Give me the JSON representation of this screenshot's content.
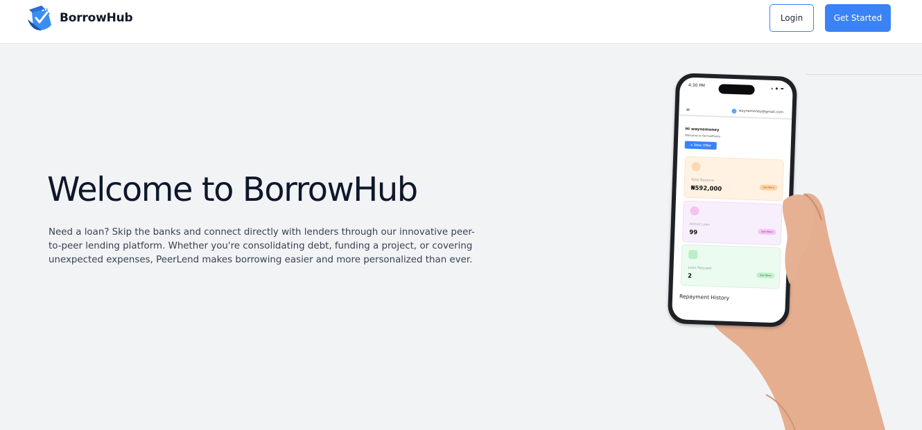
{
  "header": {
    "brand": "BorrowHub",
    "login_label": "Login",
    "get_started_label": "Get Started"
  },
  "hero": {
    "title": "Welcome to BorrowHub",
    "description": "Need a loan? Skip the banks and connect directly with lenders through our innovative peer-to-peer lending platform. Whether you're consolidating debt, funding a project, or covering unexpected expenses, PeerLend makes borrowing easier and more personalized than ever."
  },
  "phone": {
    "time": "4:30 PM",
    "email": "waynemoney@gmail.com",
    "greeting": "Hi waynemoney",
    "welcome": "Welcome to BorrowPoints",
    "new_offer": "+ New Offer",
    "cards": [
      {
        "label": "Total Balance",
        "value": "₦592,000",
        "action": "See More"
      },
      {
        "label": "Active Loan",
        "value": "99",
        "action": "See More"
      },
      {
        "label": "Loan Request",
        "value": "2",
        "action": "See More"
      }
    ],
    "repayment_history": "Repayment History"
  },
  "colors": {
    "accent": "#3b82f6",
    "background": "#f2f3f5",
    "title": "#0f172a"
  },
  "icons": {
    "logo": "borrowhub-logo-icon",
    "menu": "menu-icon",
    "avatar": "avatar-icon"
  }
}
